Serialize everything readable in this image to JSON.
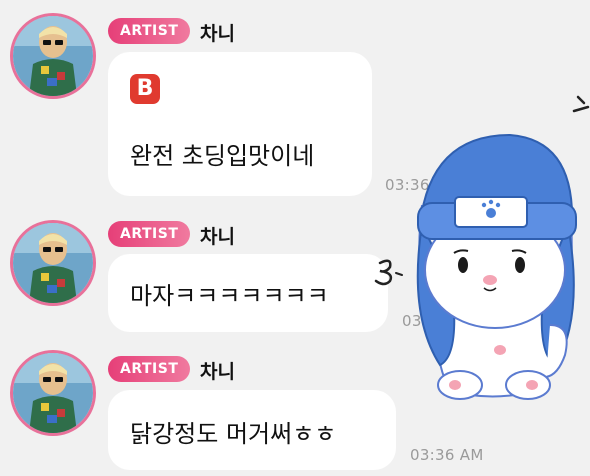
{
  "messages": [
    {
      "badge": "ARTIST",
      "name": "차니",
      "emoji": "B",
      "text": "완전 초딩입맛이네",
      "time": "03:36 AM"
    },
    {
      "badge": "ARTIST",
      "name": "차니",
      "text": "마자ㅋㅋㅋㅋㅋㅋㅋ",
      "time": "03:36 AM"
    },
    {
      "badge": "ARTIST",
      "name": "차니",
      "text": "닭강정도 머거써ㅎㅎ",
      "time": "03:36 AM"
    }
  ],
  "colors": {
    "badge": "#e63f78",
    "avatar_ring": "#e8719a",
    "background": "#f1f1f1",
    "bubble": "#ffffff",
    "emoji_b": "#e03a2f",
    "sticker_hat": "#4a7fd6"
  },
  "sticker": {
    "name": "cat-with-blue-beanie-sticker"
  }
}
